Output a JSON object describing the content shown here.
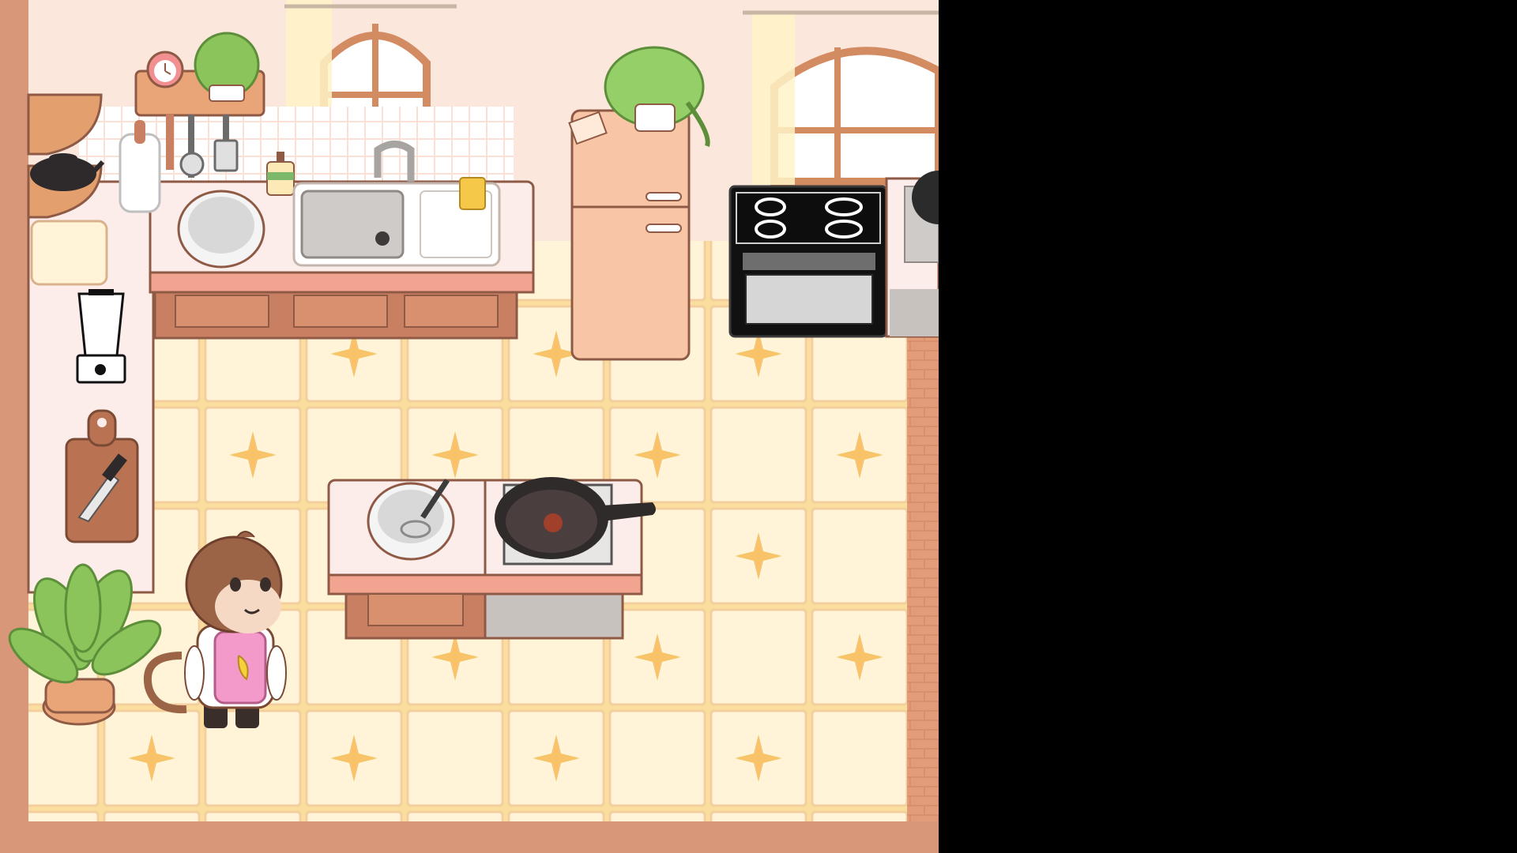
{
  "palette": {
    "wall": "#FBE7DC",
    "floor_cream": "#FFF4D8",
    "floor_yellow": "#FBDE9E",
    "star": "#F9C36B",
    "counter_top": "#FCEDEB",
    "counter_edge": "#F1A48F",
    "cabinet": "#C98062",
    "fridge": "#F9C5A7",
    "brick": "#D98F6C",
    "outline": "#8F5A45"
  },
  "objects": {
    "character": "monkey-chef",
    "apron_icon": "banana-icon",
    "appliances": [
      "oven",
      "fridge",
      "sink",
      "stove",
      "blender"
    ],
    "utensils": [
      "mixing-bowl",
      "whisk",
      "frying-pan",
      "knife",
      "cutting-board",
      "rolling-pin",
      "teapot",
      "spatula",
      "ladle"
    ],
    "decor": [
      "alarm-clock",
      "potted-plant",
      "hanging-plant",
      "large-floor-plant",
      "window",
      "curtain"
    ]
  }
}
